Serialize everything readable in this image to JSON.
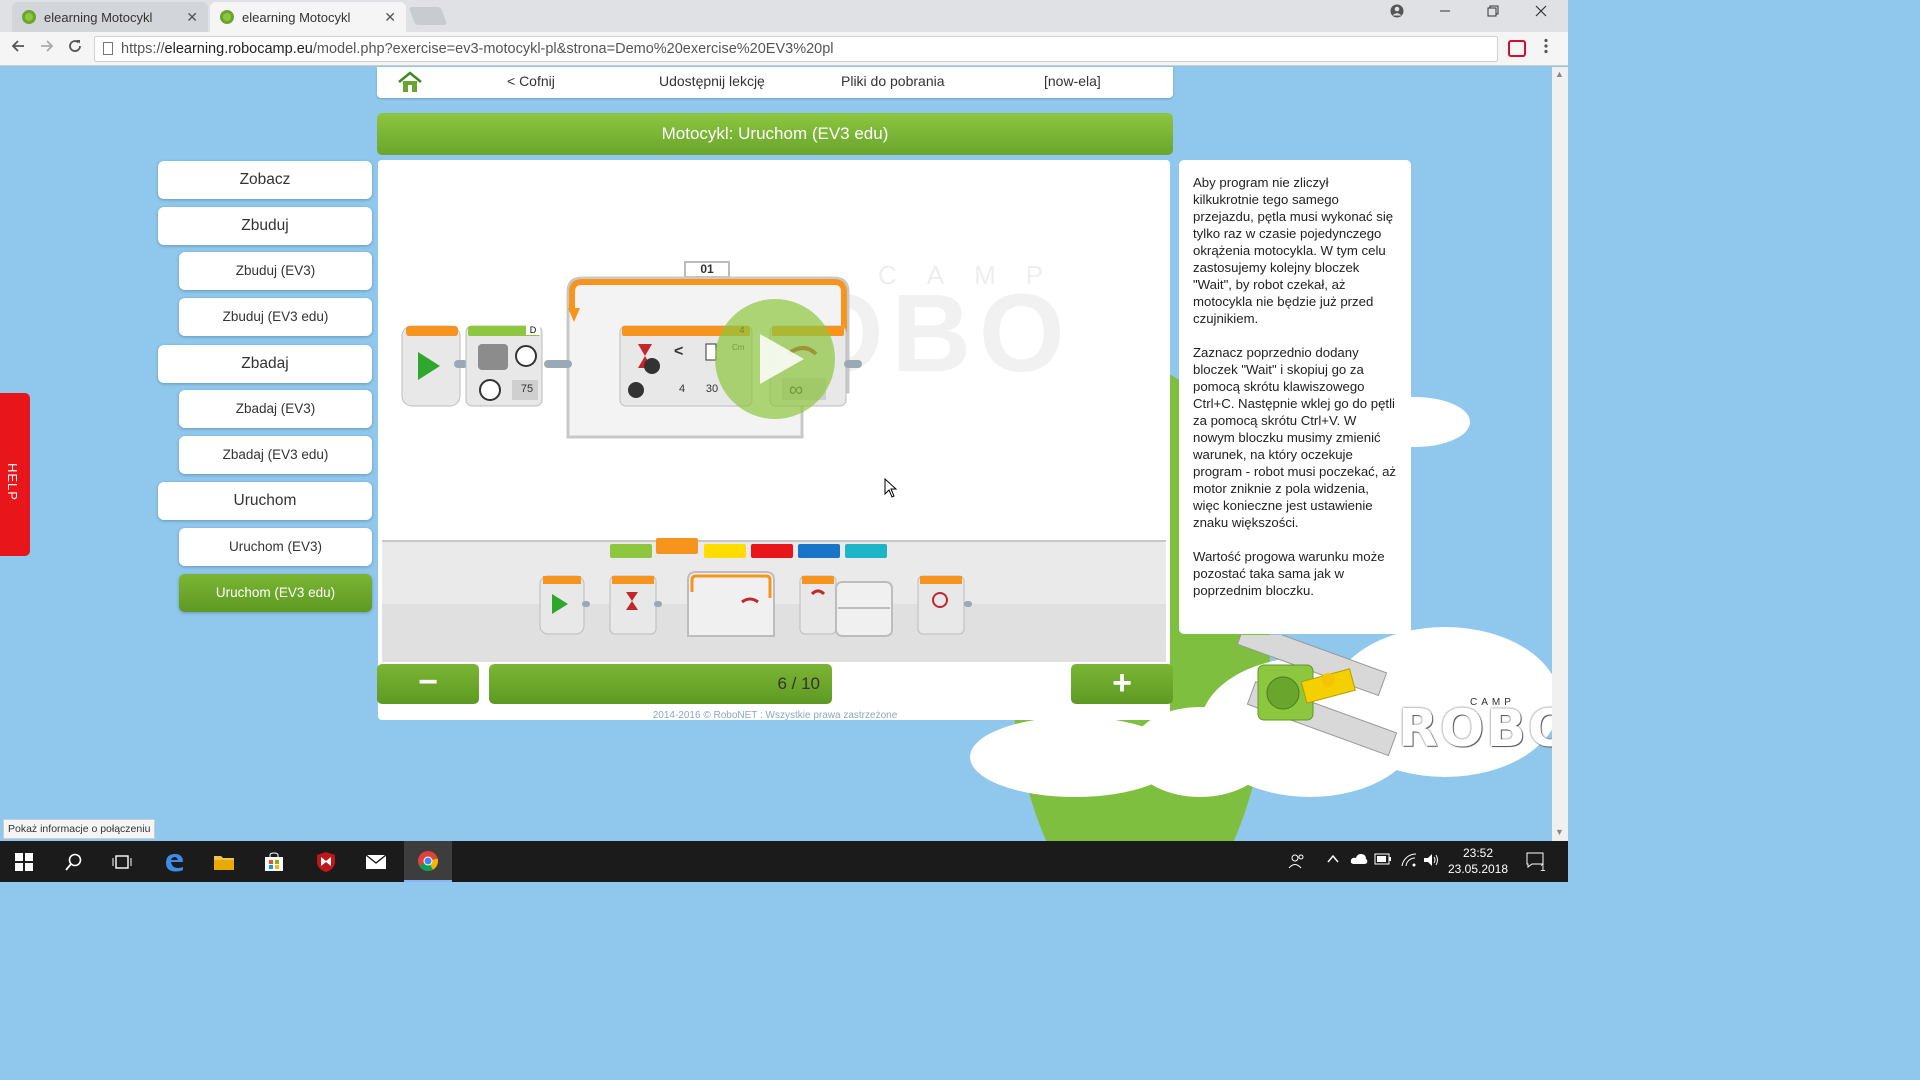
{
  "browser": {
    "tabs": [
      {
        "title": "elearning Motocykl",
        "close": "✕",
        "active": false
      },
      {
        "title": "elearning Motocykl",
        "close": "✕",
        "active": true
      }
    ],
    "url_scheme": "https://",
    "url_host": "elearning.robocamp.eu",
    "url_path": "/model.php?exercise=ev3-motocykl-pl&strona=Demo%20exercise%20EV3%20pl",
    "status_tooltip": "Pokaż informacje o połączeniu"
  },
  "topnav": {
    "back": "< Cofnij",
    "share": "Udostępnij lekcję",
    "downloads": "Pliki do pobrania",
    "user": "[now-ela]"
  },
  "title": "Motocykl: Uruchom (EV3 edu)",
  "sidebar": {
    "items": [
      {
        "label": "Zobacz"
      },
      {
        "label": "Zbuduj"
      },
      {
        "label": "Zbuduj (EV3)"
      },
      {
        "label": "Zbuduj (EV3 edu)"
      },
      {
        "label": "Zbadaj"
      },
      {
        "label": "Zbadaj (EV3)"
      },
      {
        "label": "Zbadaj (EV3 edu)"
      },
      {
        "label": "Uruchom"
      },
      {
        "label": "Uruchom (EV3)"
      },
      {
        "label": "Uruchom (EV3 edu)"
      }
    ]
  },
  "help_label": "HELP",
  "program": {
    "loop_label": "01",
    "motor_port": "D",
    "motor_power": "75",
    "wait_port": "4",
    "wait_compare_symbol": "<",
    "wait_param_1": "4",
    "wait_param_2": "30",
    "wait_unit": "Cm",
    "loop_mode": "∞",
    "watermark": "OBO",
    "watermark_camp": "CAMP"
  },
  "palette": {
    "category_colors": [
      "#8dc63f",
      "#f7941d",
      "#ffdd00",
      "#e8161b",
      "#1a75c8",
      "#1fb5c9"
    ]
  },
  "info": {
    "paragraphs": [
      "Aby program nie zliczył kilkukrotnie tego samego przejazdu, pętla musi wykonać się tylko raz w czasie pojedynczego okrążenia motocykla. W tym celu zastosujemy kolejny bloczek \"Wait\", by robot czekał, aż motocykla nie będzie już przed czujnikiem.",
      "Zaznacz poprzednio dodany bloczek \"Wait\" i skopiuj go za pomocą skrótu klawiszowego Ctrl+C. Następnie wklej go do pętli za pomocą skrótu Ctrl+V. W nowym bloczku musimy zmienić warunek, na który oczekuje program - robot musi poczekać, aż motor zniknie z pola widzenia, więc konieczne jest ustawienie znaku większości.",
      "Wartość progowa warunku może pozostać taka sama jak w poprzednim bloczku."
    ]
  },
  "pager": {
    "current": 6,
    "total": 10,
    "progress_text": "6 / 10",
    "prev_symbol": "−",
    "next_symbol": "+"
  },
  "footer": "2014-2016 © RoboNET : Wszystkie prawa zastrzeżone",
  "logo": {
    "main": "ROBO",
    "camp": "CAMP"
  },
  "taskbar": {
    "time": "23:52",
    "date": "23.05.2018",
    "notifications": "1"
  },
  "colors": {
    "accent_green": "#6aa52d",
    "sky": "#8fc8ec",
    "help_red": "#e8161b",
    "ev3_orange": "#f7941d"
  }
}
